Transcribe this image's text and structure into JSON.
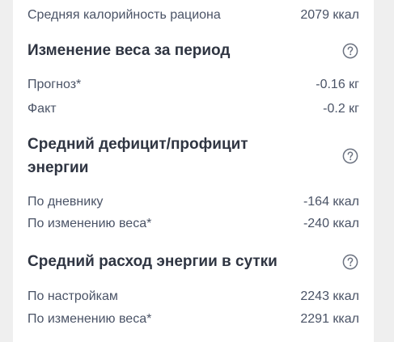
{
  "summary": {
    "calories_label": "Средняя калорийность рациона",
    "calories_value": "2079 ккал"
  },
  "weight_change": {
    "title": "Изменение веса за период",
    "help_icon": "question-circle-icon",
    "forecast_label": "Прогноз*",
    "forecast_value": "-0.16 кг",
    "fact_label": "Факт",
    "fact_value": "-0.2 кг"
  },
  "energy_balance": {
    "title_line1": "Средний дефицит/профицит",
    "title_line2": "энергии",
    "help_icon": "question-circle-icon",
    "diary_label": "По дневнику",
    "diary_value": "-164 ккал",
    "weight_label": "По изменению веса*",
    "weight_value": "-240 ккал"
  },
  "daily_expenditure": {
    "title": "Средний расход энергии в сутки",
    "help_icon": "question-circle-icon",
    "settings_label": "По настройкам",
    "settings_value": "2243 ккал",
    "weight_label": "По изменению веса*",
    "weight_value": "2291 ккал"
  },
  "colors": {
    "page_background": "#efefef",
    "card_background": "#ffffff",
    "heading_text": "#2f3542",
    "body_text": "#4a5366",
    "icon": "#6b7280"
  }
}
